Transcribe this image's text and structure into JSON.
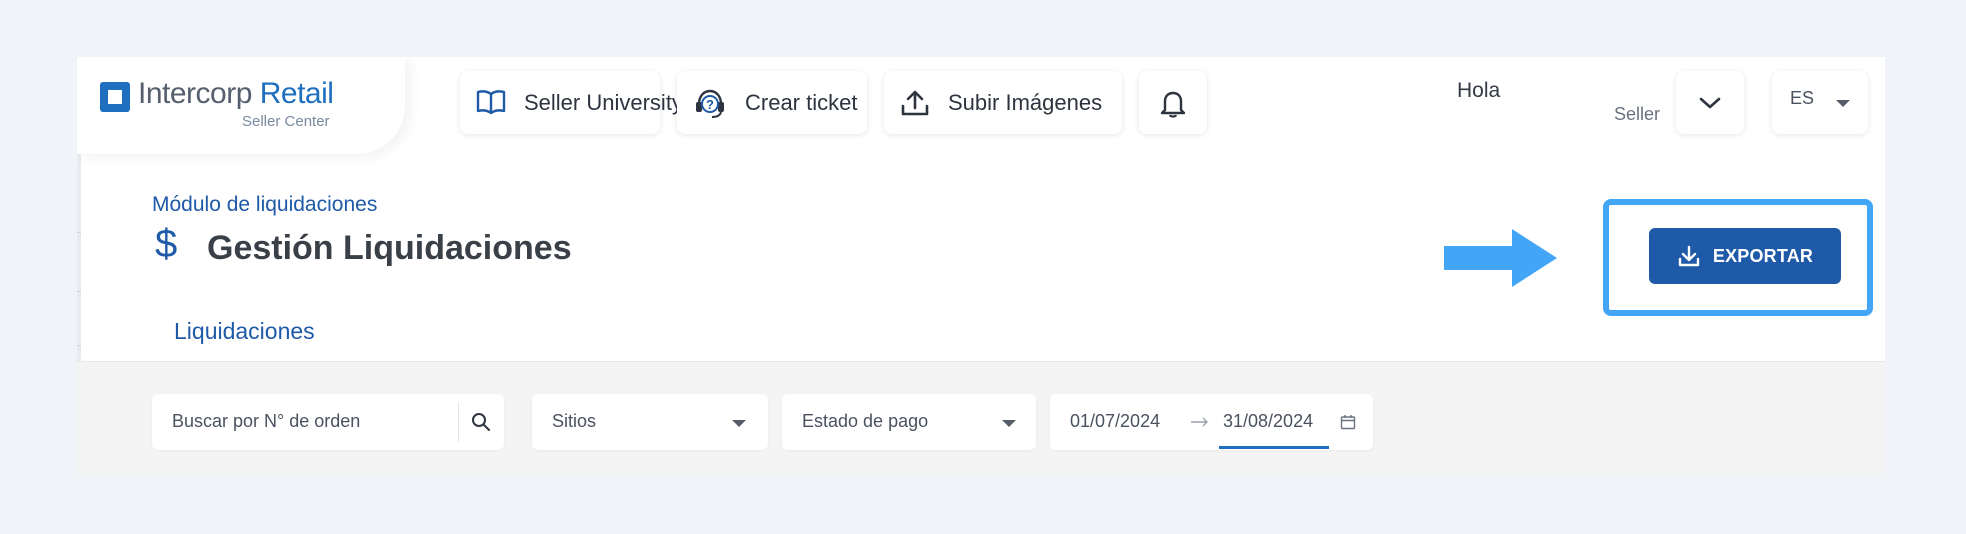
{
  "brand": {
    "name_part1": "Intercorp",
    "name_part2": "Retail",
    "subtitle": "Seller Center"
  },
  "header": {
    "seller_university": "Seller University",
    "crear_ticket": "Crear ticket",
    "subir_imagenes": "Subir Imágenes",
    "greeting": "Hola",
    "role": "Seller",
    "language": "ES"
  },
  "page": {
    "breadcrumb": "Módulo de liquidaciones",
    "currency_symbol": "$",
    "title": "Gestión Liquidaciones",
    "tab_label": "Liquidaciones",
    "export_label": "EXPORTAR"
  },
  "filters": {
    "search_placeholder": "Buscar por N° de orden",
    "sites_label": "Sitios",
    "payment_status_label": "Estado de pago",
    "date_from": "01/07/2024",
    "date_to": "31/08/2024"
  },
  "colors": {
    "primary": "#1e5aa8",
    "brand_blue": "#1e6fc0",
    "highlight": "#42a5f5",
    "page_background": "#f0f3f7"
  },
  "icons": [
    "book-icon",
    "headset-help-icon",
    "upload-icon",
    "bell-icon",
    "chevron-down-icon",
    "download-icon",
    "search-icon",
    "calendar-icon",
    "arrow-right-icon"
  ]
}
